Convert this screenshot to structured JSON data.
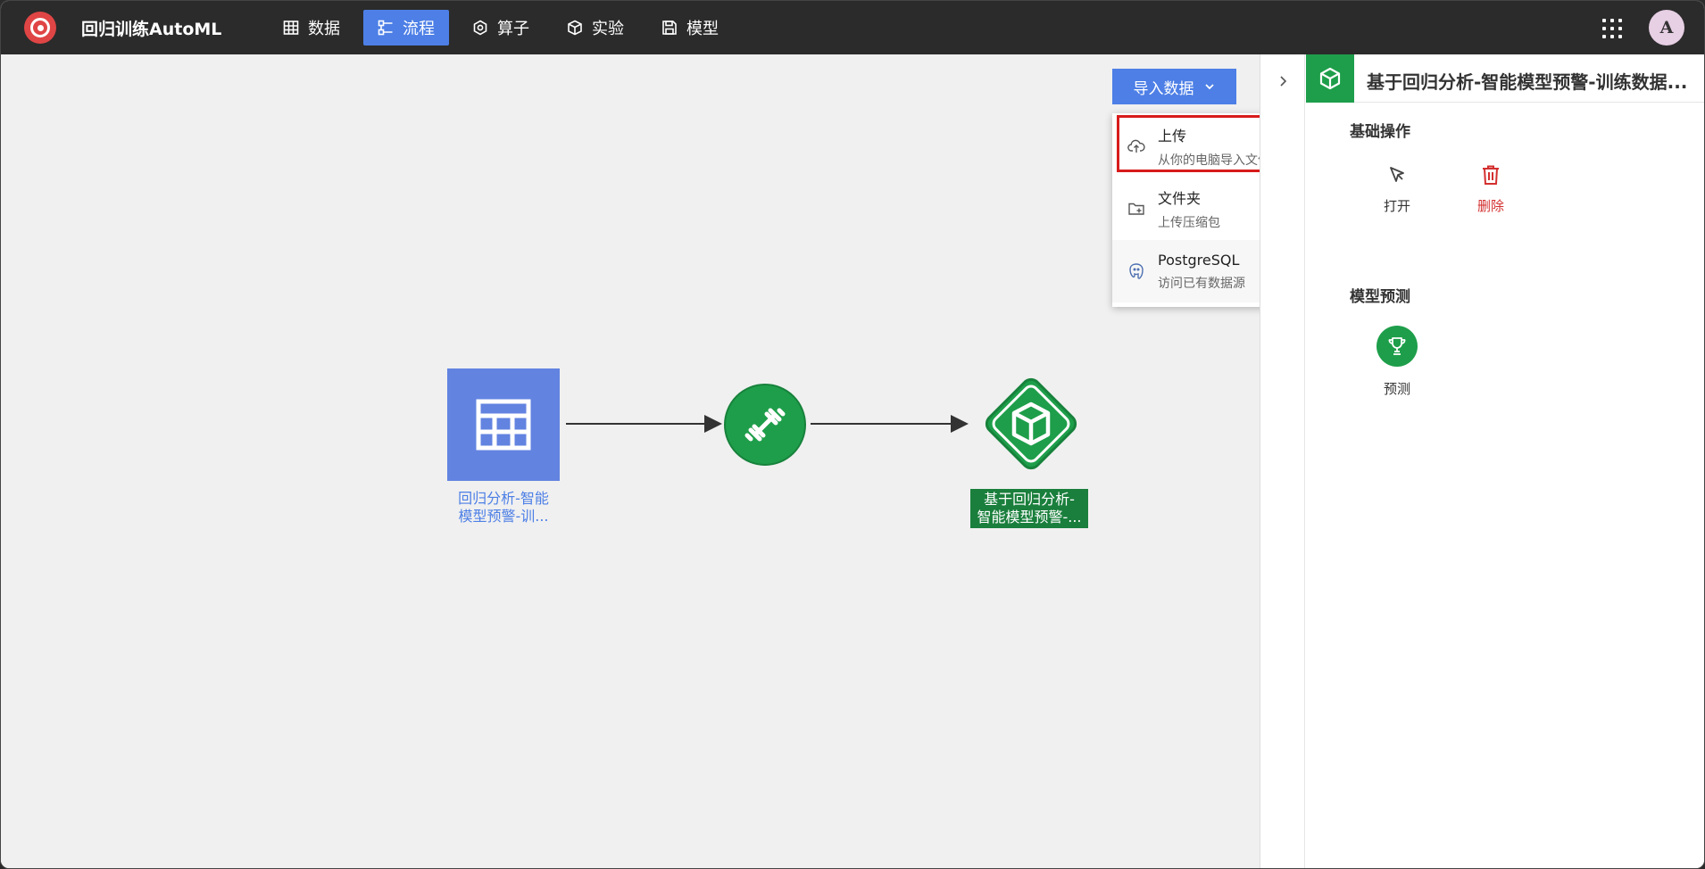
{
  "app": {
    "title": "回归训练AutoML",
    "avatar_letter": "A"
  },
  "nav": {
    "items": [
      {
        "label": "数据",
        "icon": "table-icon"
      },
      {
        "label": "流程",
        "icon": "flow-icon",
        "active": true
      },
      {
        "label": "算子",
        "icon": "hexagon-icon"
      },
      {
        "label": "实验",
        "icon": "cube-icon"
      },
      {
        "label": "模型",
        "icon": "save-icon"
      }
    ]
  },
  "canvas": {
    "import_button": "导入数据",
    "dropdown": [
      {
        "title": "上传",
        "subtitle": "从你的电脑导入文件",
        "icon": "cloud-upload-icon"
      },
      {
        "title": "文件夹",
        "subtitle": "上传压缩包",
        "icon": "folder-add-icon"
      },
      {
        "title": "PostgreSQL",
        "subtitle": "访问已有数据源",
        "icon": "postgresql-icon"
      }
    ],
    "nodes": {
      "dataset_label_line1": "回归分析-智能",
      "dataset_label_line2": "模型预警-训...",
      "model_label_line1": "基于回归分析-",
      "model_label_line2": "智能模型预警-..."
    }
  },
  "panel": {
    "title": "基于回归分析-智能模型预警-训练数据...",
    "basic_ops_title": "基础操作",
    "open_label": "打开",
    "delete_label": "删除",
    "predict_title": "模型预测",
    "predict_label": "预测"
  },
  "colors": {
    "accent": "#4d7fe6",
    "green": "#1e9e4a",
    "danger": "#d32f2f",
    "topbar": "#2b2b2b"
  }
}
